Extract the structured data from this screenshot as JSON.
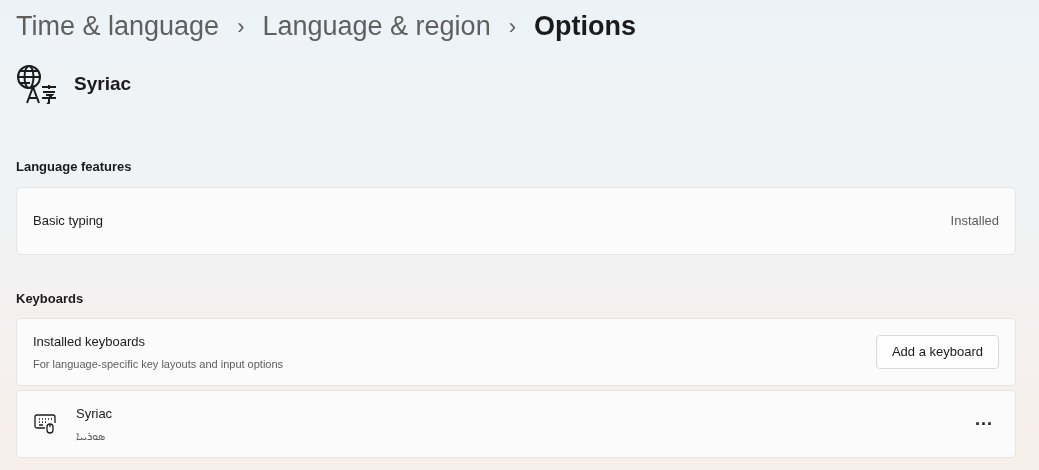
{
  "breadcrumb": [
    {
      "label": "Time & language",
      "current": false
    },
    {
      "label": "Language & region",
      "current": false
    },
    {
      "label": "Options",
      "current": true
    }
  ],
  "separator": "›",
  "language": {
    "name": "Syriac"
  },
  "sections": [
    {
      "title": "Language features",
      "rows": [
        {
          "kind": "status",
          "title": "Basic typing",
          "status": "Installed"
        }
      ]
    },
    {
      "title": "Keyboards",
      "rows": [
        {
          "kind": "action",
          "title": "Installed keyboards",
          "subtitle": "For language-specific key layouts and input options",
          "button": "Add a keyboard"
        },
        {
          "kind": "keyboard",
          "title": "Syriac",
          "subtitle": "ܣܘܪܝܝܐ",
          "menu": "···"
        }
      ]
    }
  ]
}
